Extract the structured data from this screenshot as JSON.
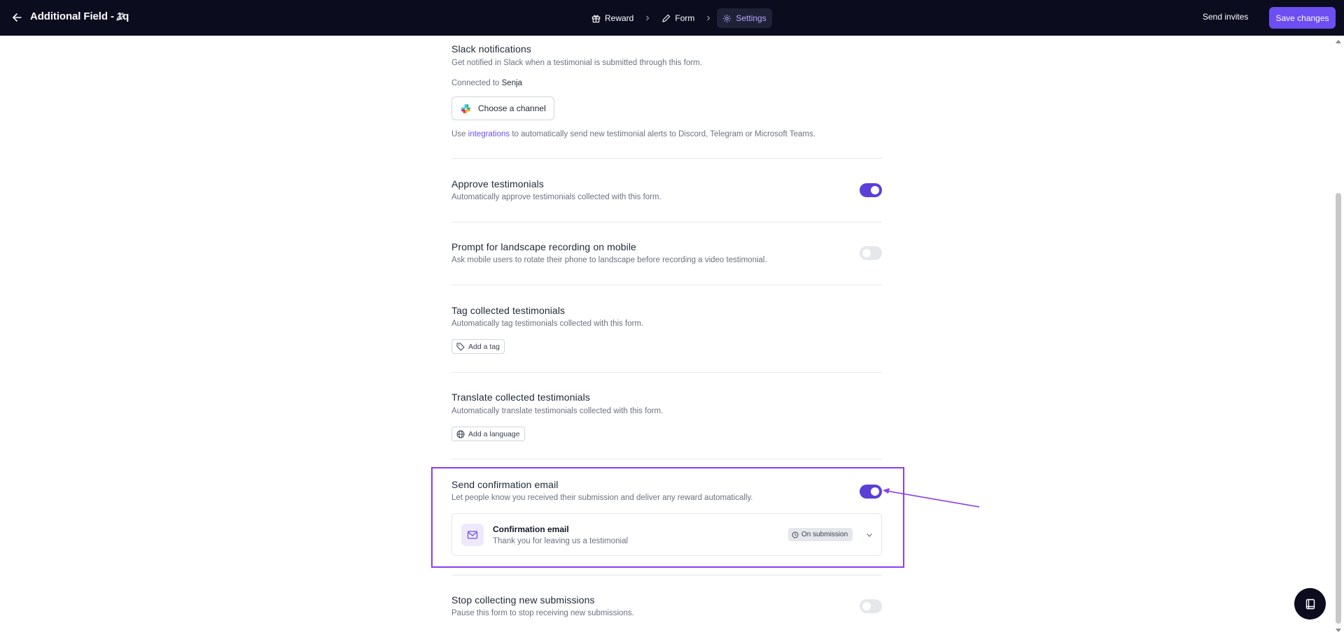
{
  "header": {
    "title": "Additional Field - 1q",
    "steps": [
      {
        "label": "Reward",
        "icon": "gift-icon"
      },
      {
        "label": "Form",
        "icon": "pencil-icon"
      },
      {
        "label": "Settings",
        "icon": "gear-icon"
      }
    ],
    "active_step": "Settings",
    "send_invites_label": "Send invites",
    "save_label": "Save changes"
  },
  "slack": {
    "title": "Slack notifications",
    "description": "Get notified in Slack when a testimonial is submitted through this form.",
    "connected_prefix": "Connected to",
    "connected_workspace": "Senja",
    "channel_button_label": "Choose a channel",
    "note_prefix": "Use",
    "note_link": "integrations",
    "note_suffix": "to automatically send new testimonial alerts to Discord, Telegram or Microsoft Teams."
  },
  "approve": {
    "title": "Approve testimonials",
    "description": "Automatically approve testimonials collected with this form.",
    "enabled": true
  },
  "landscape": {
    "title": "Prompt for landscape recording on mobile",
    "description": "Ask mobile users to rotate their phone to landscape before recording a video testimonial.",
    "enabled": false
  },
  "tags": {
    "title": "Tag collected testimonials",
    "description": "Automatically tag testimonials collected with this form.",
    "button_label": "Add a tag"
  },
  "translate": {
    "title": "Translate collected testimonials",
    "description": "Automatically translate testimonials collected with this form.",
    "button_label": "Add a language"
  },
  "confirmation": {
    "title": "Send confirmation email",
    "description": "Let people know you received their submission and deliver any reward automatically.",
    "enabled": true,
    "email": {
      "title": "Confirmation email",
      "subtitle": "Thank you for leaving us a testimonial",
      "trigger_label": "On submission"
    }
  },
  "stop": {
    "title": "Stop collecting new submissions",
    "description": "Pause this form to stop receiving new submissions.",
    "enabled": false
  },
  "colors": {
    "topbar_bg": "#0b0c1e",
    "accent": "#6c4ef2",
    "toggle_on": "#5b3fd9",
    "highlight_border": "#8b3cf0"
  }
}
